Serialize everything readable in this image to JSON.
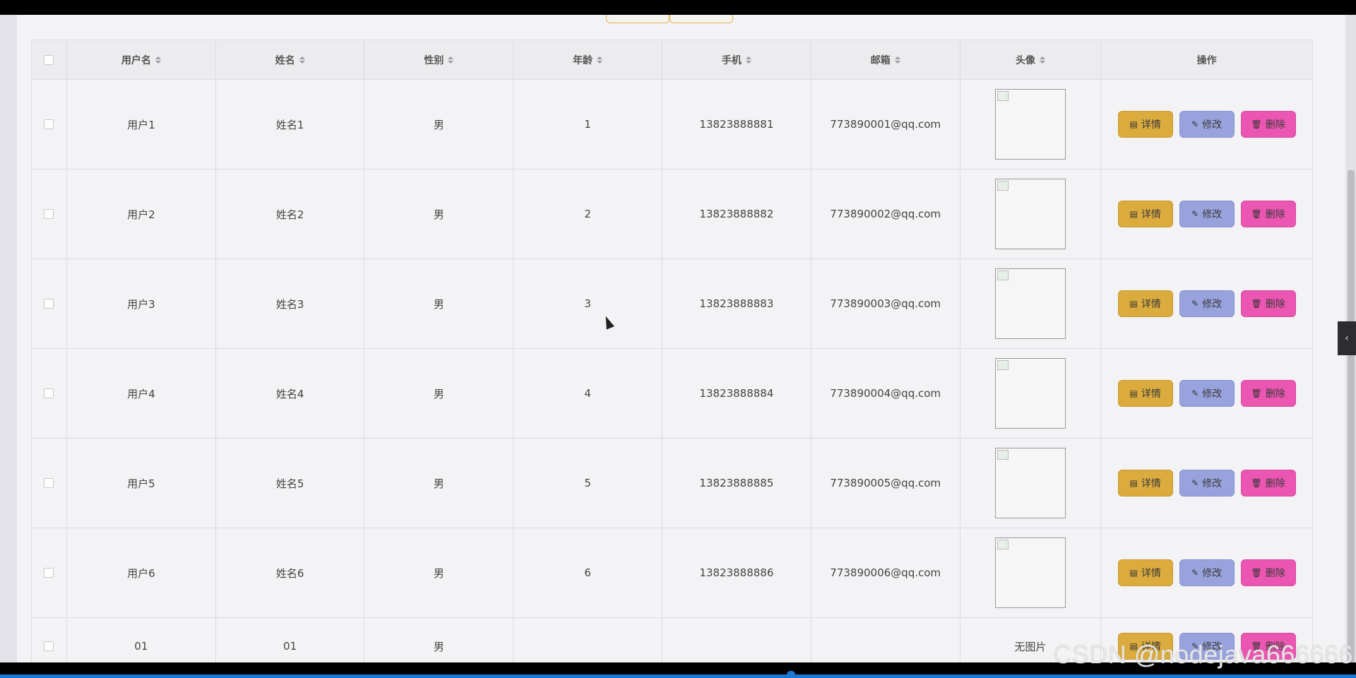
{
  "table": {
    "headers": [
      "用户名",
      "姓名",
      "性别",
      "年龄",
      "手机",
      "邮箱",
      "头像",
      "操作"
    ],
    "rows": [
      {
        "username": "用户1",
        "name": "姓名1",
        "gender": "男",
        "age": "1",
        "phone": "13823888881",
        "email": "773890001@qq.com",
        "avatar": ""
      },
      {
        "username": "用户2",
        "name": "姓名2",
        "gender": "男",
        "age": "2",
        "phone": "13823888882",
        "email": "773890002@qq.com",
        "avatar": ""
      },
      {
        "username": "用户3",
        "name": "姓名3",
        "gender": "男",
        "age": "3",
        "phone": "13823888883",
        "email": "773890003@qq.com",
        "avatar": ""
      },
      {
        "username": "用户4",
        "name": "姓名4",
        "gender": "男",
        "age": "4",
        "phone": "13823888884",
        "email": "773890004@qq.com",
        "avatar": ""
      },
      {
        "username": "用户5",
        "name": "姓名5",
        "gender": "男",
        "age": "5",
        "phone": "13823888885",
        "email": "773890005@qq.com",
        "avatar": ""
      },
      {
        "username": "用户6",
        "name": "姓名6",
        "gender": "男",
        "age": "6",
        "phone": "13823888886",
        "email": "773890006@qq.com",
        "avatar": ""
      },
      {
        "username": "01",
        "name": "01",
        "gender": "男",
        "age": "",
        "phone": "",
        "email": "",
        "avatar": "无图片"
      }
    ],
    "actions": {
      "detail": "详情",
      "edit": "修改",
      "delete": "删除"
    }
  },
  "watermark": "CSDN @nodejava666666",
  "colors": {
    "detail": "#dbab3e",
    "edit": "#98a3dd",
    "delete": "#ea56b1"
  }
}
